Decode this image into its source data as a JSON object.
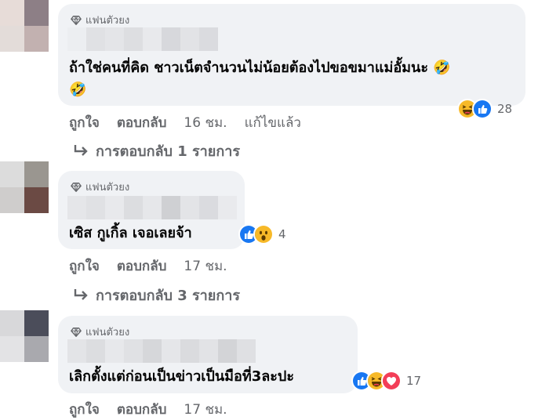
{
  "colors": {
    "bubble": "#f0f2f5",
    "secondary_text": "#65676b",
    "like_blue": "#1877f2",
    "haha_yellow": "#f7b928",
    "love_red": "#f33e58"
  },
  "comments": [
    {
      "badge": "แฟนตัวยง",
      "text_line1": "ถ้าใช่คนที่คิด ชาวเน็ตจำนวนไม่น้อยต้องไปขอขมาแม่อั้มนะ 🤣",
      "text_line2": "🤣",
      "reaction_icons": [
        "haha-icon",
        "like-icon"
      ],
      "reaction_count": "28",
      "like_label": "ถูกใจ",
      "reply_label": "ตอบกลับ",
      "time": "16 ชม.",
      "edited_label": "แก้ไขแล้ว",
      "replies_label": "การตอบกลับ 1 รายการ"
    },
    {
      "badge": "แฟนตัวยง",
      "text_line1": "เซิส กูเกิ้ล เจอเลยจ้า",
      "reaction_icons": [
        "like-icon",
        "wow-icon"
      ],
      "reaction_count": "4",
      "like_label": "ถูกใจ",
      "reply_label": "ตอบกลับ",
      "time": "17 ชม.",
      "replies_label": "การตอบกลับ 3 รายการ"
    },
    {
      "badge": "แฟนตัวยง",
      "text_line1": "เลิกตั้งแต่ก่อนเป็นข่าวเป็นมือที่3ละปะ",
      "reaction_icons": [
        "like-icon",
        "haha-icon",
        "love-icon"
      ],
      "reaction_count": "17",
      "like_label": "ถูกใจ",
      "reply_label": "ตอบกลับ",
      "time": "17 ชม."
    }
  ]
}
